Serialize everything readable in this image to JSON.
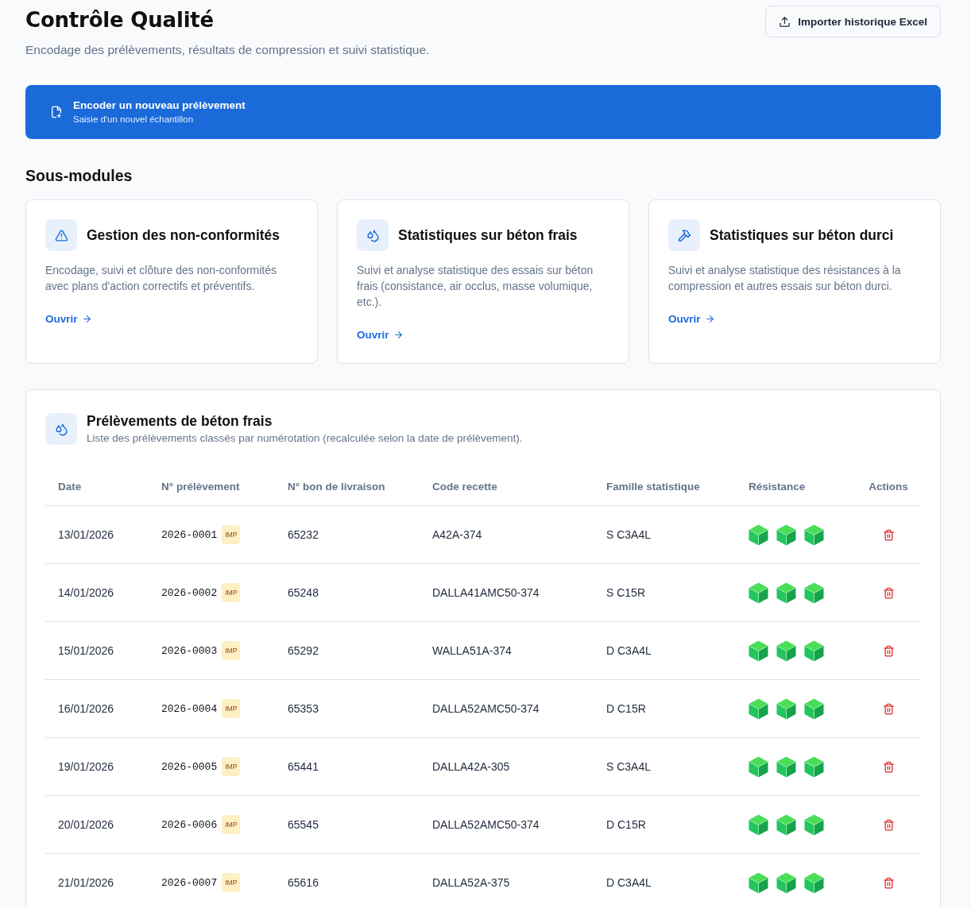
{
  "header": {
    "title": "Contrôle Qualité",
    "subtitle": "Encodage des prélèvements, résultats de compression et suivi statistique.",
    "import_button": "Importer historique Excel"
  },
  "banner": {
    "title": "Encoder un nouveau prélèvement",
    "subtitle": "Saisie d'un nouvel échantillon"
  },
  "submodules": {
    "heading": "Sous-modules",
    "cards": [
      {
        "kind": "alert",
        "title": "Gestion des non-conformités",
        "description": "Encodage, suivi et clôture des non-conformités avec plans d'action correctifs et préventifs.",
        "link": "Ouvrir"
      },
      {
        "kind": "droplets",
        "title": "Statistiques sur béton frais",
        "description": "Suivi et analyse statistique des essais sur béton frais (consistance, air occlus, masse volumique, etc.).",
        "link": "Ouvrir"
      },
      {
        "kind": "hammer",
        "title": "Statistiques sur béton durci",
        "description": "Suivi et analyse statistique des résistances à la compression et autres essais sur béton durci.",
        "link": "Ouvrir"
      }
    ]
  },
  "samples": {
    "title": "Prélèvements de béton frais",
    "subtitle": "Liste des prélèvements classés par numérotation (recalculée selon la date de prélèvement).",
    "columns": [
      "Date",
      "N° prélèvement",
      "N° bon de livraison",
      "Code recette",
      "Famille statistique",
      "Résistance",
      "Actions"
    ],
    "rows": [
      {
        "date": "13/01/2026",
        "number": "2026-0001",
        "badge": "IMP",
        "delivery_note": "65232",
        "recipe_code": "A42A-374",
        "family": "S C3A4L",
        "cubes": [
          {
            "kind": "ok"
          },
          {
            "kind": "ok"
          },
          {
            "kind": "ok"
          }
        ]
      },
      {
        "date": "14/01/2026",
        "number": "2026-0002",
        "badge": "IMP",
        "delivery_note": "65248",
        "recipe_code": "DALLA41AMC50-374",
        "family": "S C15R",
        "cubes": [
          {
            "kind": "ok"
          },
          {
            "kind": "ok"
          },
          {
            "kind": "ok"
          }
        ]
      },
      {
        "date": "15/01/2026",
        "number": "2026-0003",
        "badge": "IMP",
        "delivery_note": "65292",
        "recipe_code": "WALLA51A-374",
        "family": "D C3A4L",
        "cubes": [
          {
            "kind": "ok"
          },
          {
            "kind": "ok"
          },
          {
            "kind": "ok"
          }
        ]
      },
      {
        "date": "16/01/2026",
        "number": "2026-0004",
        "badge": "IMP",
        "delivery_note": "65353",
        "recipe_code": "DALLA52AMC50-374",
        "family": "D C15R",
        "cubes": [
          {
            "kind": "ok"
          },
          {
            "kind": "ok"
          },
          {
            "kind": "ok"
          }
        ]
      },
      {
        "date": "19/01/2026",
        "number": "2026-0005",
        "badge": "IMP",
        "delivery_note": "65441",
        "recipe_code": "DALLA42A-305",
        "family": "S C3A4L",
        "cubes": [
          {
            "kind": "ok"
          },
          {
            "kind": "ok"
          },
          {
            "kind": "ok"
          }
        ]
      },
      {
        "date": "20/01/2026",
        "number": "2026-0006",
        "badge": "IMP",
        "delivery_note": "65545",
        "recipe_code": "DALLA52AMC50-374",
        "family": "D C15R",
        "cubes": [
          {
            "kind": "ok"
          },
          {
            "kind": "ok"
          },
          {
            "kind": "ok"
          }
        ]
      },
      {
        "date": "21/01/2026",
        "number": "2026-0007",
        "badge": "IMP",
        "delivery_note": "65616",
        "recipe_code": "DALLA52A-375",
        "family": "D C3A4L",
        "cubes": [
          {
            "kind": "ok"
          },
          {
            "kind": "ok"
          },
          {
            "kind": "ok"
          }
        ]
      }
    ]
  }
}
